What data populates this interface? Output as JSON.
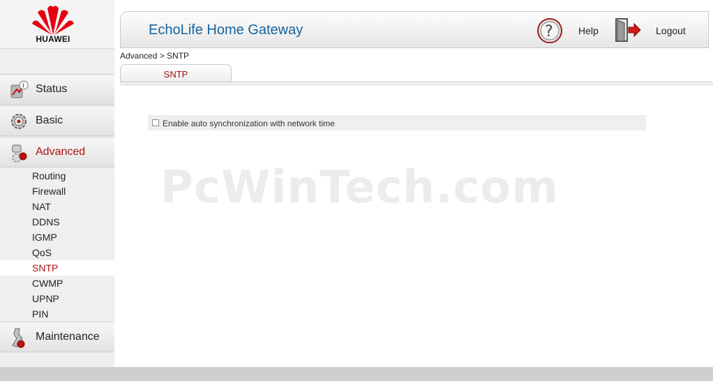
{
  "brand": {
    "logo_text": "HUAWEI",
    "logo_color": "#e60012"
  },
  "header": {
    "title": "EchoLife Home Gateway",
    "help_label": "Help",
    "logout_label": "Logout",
    "help_icon": "question-icon",
    "logout_icon": "door-exit-icon"
  },
  "sidebar": {
    "sections": [
      {
        "label": "Status",
        "icon": "status-icon",
        "active": false
      },
      {
        "label": "Basic",
        "icon": "gear-icon",
        "active": false
      },
      {
        "label": "Advanced",
        "icon": "advanced-icon",
        "active": true
      },
      {
        "label": "Maintenance",
        "icon": "wrench-icon",
        "active": false
      }
    ],
    "advanced_items": [
      {
        "label": "Routing"
      },
      {
        "label": "Firewall"
      },
      {
        "label": "NAT"
      },
      {
        "label": "DDNS"
      },
      {
        "label": "IGMP"
      },
      {
        "label": "QoS"
      },
      {
        "label": "SNTP",
        "active": true
      },
      {
        "label": "CWMP"
      },
      {
        "label": "UPNP"
      },
      {
        "label": "PIN"
      }
    ]
  },
  "main": {
    "breadcrumb": "Advanced > SNTP",
    "tab_label": "SNTP",
    "auto_sync": {
      "label": "Enable auto synchronization with network time",
      "checked": false
    }
  },
  "watermark": "PcWinTech.com",
  "colors": {
    "accent_red": "#b01010",
    "title_blue": "#1464a0"
  }
}
